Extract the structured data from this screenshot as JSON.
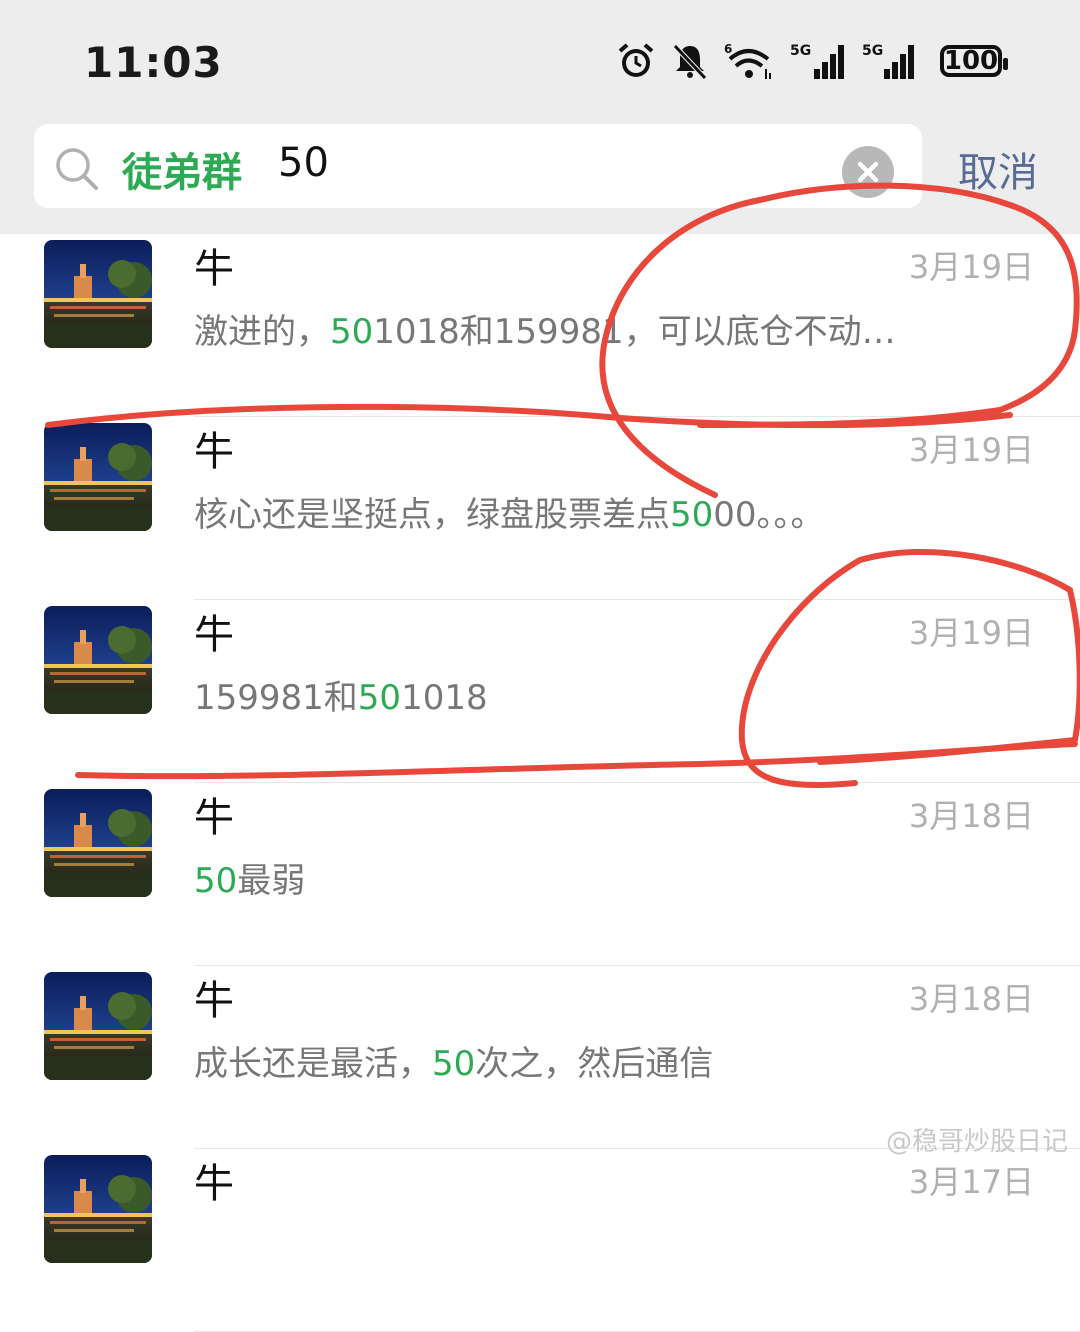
{
  "status": {
    "time": "11:03",
    "battery": "100",
    "icons": [
      "alarm-icon",
      "mute-icon",
      "wifi-icon",
      "signal-5g-icon",
      "signal-5g-icon"
    ]
  },
  "search": {
    "tag": "徒弟群",
    "query": "50",
    "cancel_label": "取消"
  },
  "results": [
    {
      "name": "牛",
      "date": "3月19日",
      "pre": "激进的，",
      "hl": "50",
      "post": "1018和159981，可以底仓不动…"
    },
    {
      "name": "牛",
      "date": "3月19日",
      "pre": "核心还是坚挺点，绿盘股票差点",
      "hl": "50",
      "post": "00。。。"
    },
    {
      "name": "牛",
      "date": "3月19日",
      "pre": "159981和",
      "hl": "50",
      "post": "1018"
    },
    {
      "name": "牛",
      "date": "3月18日",
      "pre": "",
      "hl": "50",
      "post": "最弱"
    },
    {
      "name": "牛",
      "date": "3月18日",
      "pre": "成长还是最活，",
      "hl": "50",
      "post": "次之，然后通信"
    },
    {
      "name": "牛",
      "date": "3月17日",
      "pre": "",
      "hl": "",
      "post": ""
    }
  ],
  "colors": {
    "highlight": "#2daa54",
    "link": "#576b95",
    "annotation": "#e8473c"
  },
  "watermark": "@稳哥炒股日记"
}
